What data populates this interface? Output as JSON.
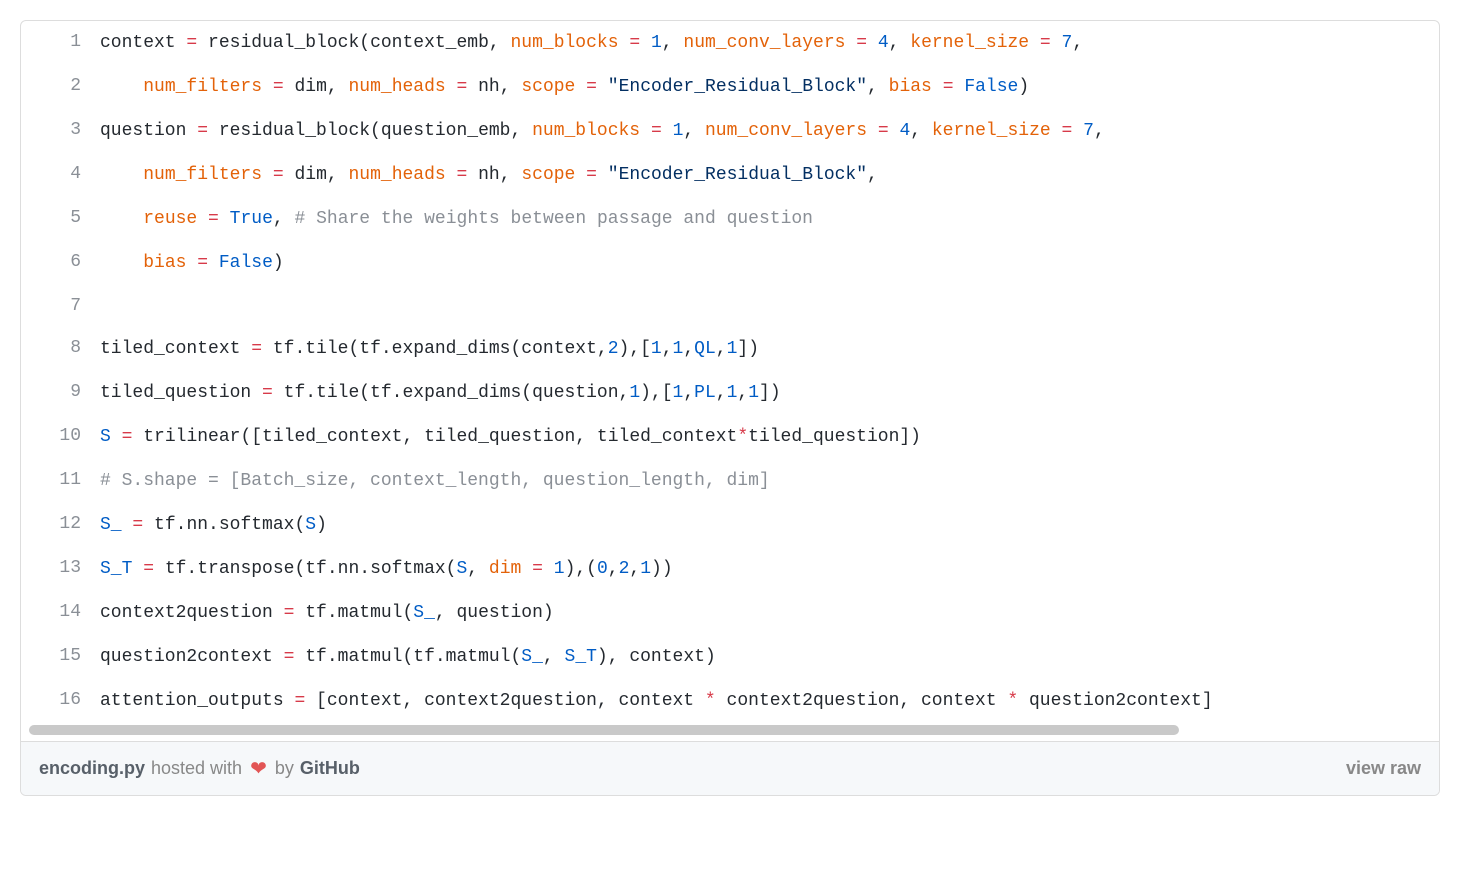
{
  "lines": [
    {
      "n": "1",
      "tokens": [
        {
          "t": "context ",
          "c": "tok-default"
        },
        {
          "t": "=",
          "c": "tok-op"
        },
        {
          "t": " residual_block(context_emb, ",
          "c": "tok-fn"
        },
        {
          "t": "num_blocks",
          "c": "tok-kw"
        },
        {
          "t": " ",
          "c": "tok-default"
        },
        {
          "t": "=",
          "c": "tok-op"
        },
        {
          "t": " ",
          "c": "tok-default"
        },
        {
          "t": "1",
          "c": "tok-num"
        },
        {
          "t": ", ",
          "c": "tok-default"
        },
        {
          "t": "num_conv_layers",
          "c": "tok-kw"
        },
        {
          "t": " ",
          "c": "tok-default"
        },
        {
          "t": "=",
          "c": "tok-op"
        },
        {
          "t": " ",
          "c": "tok-default"
        },
        {
          "t": "4",
          "c": "tok-num"
        },
        {
          "t": ", ",
          "c": "tok-default"
        },
        {
          "t": "kernel_size",
          "c": "tok-kw"
        },
        {
          "t": " ",
          "c": "tok-default"
        },
        {
          "t": "=",
          "c": "tok-op"
        },
        {
          "t": " ",
          "c": "tok-default"
        },
        {
          "t": "7",
          "c": "tok-num"
        },
        {
          "t": ",",
          "c": "tok-default"
        }
      ]
    },
    {
      "n": "2",
      "tokens": [
        {
          "t": "    ",
          "c": "tok-default"
        },
        {
          "t": "num_filters",
          "c": "tok-kw"
        },
        {
          "t": " ",
          "c": "tok-default"
        },
        {
          "t": "=",
          "c": "tok-op"
        },
        {
          "t": " dim, ",
          "c": "tok-default"
        },
        {
          "t": "num_heads",
          "c": "tok-kw"
        },
        {
          "t": " ",
          "c": "tok-default"
        },
        {
          "t": "=",
          "c": "tok-op"
        },
        {
          "t": " nh, ",
          "c": "tok-default"
        },
        {
          "t": "scope",
          "c": "tok-kw"
        },
        {
          "t": " ",
          "c": "tok-default"
        },
        {
          "t": "=",
          "c": "tok-op"
        },
        {
          "t": " ",
          "c": "tok-default"
        },
        {
          "t": "\"Encoder_Residual_Block\"",
          "c": "tok-str"
        },
        {
          "t": ", ",
          "c": "tok-default"
        },
        {
          "t": "bias",
          "c": "tok-kw"
        },
        {
          "t": " ",
          "c": "tok-default"
        },
        {
          "t": "=",
          "c": "tok-op"
        },
        {
          "t": " ",
          "c": "tok-default"
        },
        {
          "t": "False",
          "c": "tok-const"
        },
        {
          "t": ")",
          "c": "tok-default"
        }
      ]
    },
    {
      "n": "3",
      "tokens": [
        {
          "t": "question ",
          "c": "tok-default"
        },
        {
          "t": "=",
          "c": "tok-op"
        },
        {
          "t": " residual_block(question_emb, ",
          "c": "tok-fn"
        },
        {
          "t": "num_blocks",
          "c": "tok-kw"
        },
        {
          "t": " ",
          "c": "tok-default"
        },
        {
          "t": "=",
          "c": "tok-op"
        },
        {
          "t": " ",
          "c": "tok-default"
        },
        {
          "t": "1",
          "c": "tok-num"
        },
        {
          "t": ", ",
          "c": "tok-default"
        },
        {
          "t": "num_conv_layers",
          "c": "tok-kw"
        },
        {
          "t": " ",
          "c": "tok-default"
        },
        {
          "t": "=",
          "c": "tok-op"
        },
        {
          "t": " ",
          "c": "tok-default"
        },
        {
          "t": "4",
          "c": "tok-num"
        },
        {
          "t": ", ",
          "c": "tok-default"
        },
        {
          "t": "kernel_size",
          "c": "tok-kw"
        },
        {
          "t": " ",
          "c": "tok-default"
        },
        {
          "t": "=",
          "c": "tok-op"
        },
        {
          "t": " ",
          "c": "tok-default"
        },
        {
          "t": "7",
          "c": "tok-num"
        },
        {
          "t": ",",
          "c": "tok-default"
        }
      ]
    },
    {
      "n": "4",
      "tokens": [
        {
          "t": "    ",
          "c": "tok-default"
        },
        {
          "t": "num_filters",
          "c": "tok-kw"
        },
        {
          "t": " ",
          "c": "tok-default"
        },
        {
          "t": "=",
          "c": "tok-op"
        },
        {
          "t": " dim, ",
          "c": "tok-default"
        },
        {
          "t": "num_heads",
          "c": "tok-kw"
        },
        {
          "t": " ",
          "c": "tok-default"
        },
        {
          "t": "=",
          "c": "tok-op"
        },
        {
          "t": " nh, ",
          "c": "tok-default"
        },
        {
          "t": "scope",
          "c": "tok-kw"
        },
        {
          "t": " ",
          "c": "tok-default"
        },
        {
          "t": "=",
          "c": "tok-op"
        },
        {
          "t": " ",
          "c": "tok-default"
        },
        {
          "t": "\"Encoder_Residual_Block\"",
          "c": "tok-str"
        },
        {
          "t": ",",
          "c": "tok-default"
        }
      ]
    },
    {
      "n": "5",
      "tokens": [
        {
          "t": "    ",
          "c": "tok-default"
        },
        {
          "t": "reuse",
          "c": "tok-kw"
        },
        {
          "t": " ",
          "c": "tok-default"
        },
        {
          "t": "=",
          "c": "tok-op"
        },
        {
          "t": " ",
          "c": "tok-default"
        },
        {
          "t": "True",
          "c": "tok-const"
        },
        {
          "t": ", ",
          "c": "tok-default"
        },
        {
          "t": "# Share the weights between passage and question",
          "c": "tok-comment"
        }
      ]
    },
    {
      "n": "6",
      "tokens": [
        {
          "t": "    ",
          "c": "tok-default"
        },
        {
          "t": "bias",
          "c": "tok-kw"
        },
        {
          "t": " ",
          "c": "tok-default"
        },
        {
          "t": "=",
          "c": "tok-op"
        },
        {
          "t": " ",
          "c": "tok-default"
        },
        {
          "t": "False",
          "c": "tok-const"
        },
        {
          "t": ")",
          "c": "tok-default"
        }
      ]
    },
    {
      "n": "7",
      "tokens": [
        {
          "t": "",
          "c": "tok-default"
        }
      ]
    },
    {
      "n": "8",
      "tokens": [
        {
          "t": "tiled_context ",
          "c": "tok-default"
        },
        {
          "t": "=",
          "c": "tok-op"
        },
        {
          "t": " tf.tile(tf.expand_dims(context,",
          "c": "tok-default"
        },
        {
          "t": "2",
          "c": "tok-num"
        },
        {
          "t": "),[",
          "c": "tok-default"
        },
        {
          "t": "1",
          "c": "tok-num"
        },
        {
          "t": ",",
          "c": "tok-default"
        },
        {
          "t": "1",
          "c": "tok-num"
        },
        {
          "t": ",",
          "c": "tok-default"
        },
        {
          "t": "QL",
          "c": "tok-name"
        },
        {
          "t": ",",
          "c": "tok-default"
        },
        {
          "t": "1",
          "c": "tok-num"
        },
        {
          "t": "])",
          "c": "tok-default"
        }
      ]
    },
    {
      "n": "9",
      "tokens": [
        {
          "t": "tiled_question ",
          "c": "tok-default"
        },
        {
          "t": "=",
          "c": "tok-op"
        },
        {
          "t": " tf.tile(tf.expand_dims(question,",
          "c": "tok-default"
        },
        {
          "t": "1",
          "c": "tok-num"
        },
        {
          "t": "),[",
          "c": "tok-default"
        },
        {
          "t": "1",
          "c": "tok-num"
        },
        {
          "t": ",",
          "c": "tok-default"
        },
        {
          "t": "PL",
          "c": "tok-name"
        },
        {
          "t": ",",
          "c": "tok-default"
        },
        {
          "t": "1",
          "c": "tok-num"
        },
        {
          "t": ",",
          "c": "tok-default"
        },
        {
          "t": "1",
          "c": "tok-num"
        },
        {
          "t": "])",
          "c": "tok-default"
        }
      ]
    },
    {
      "n": "10",
      "tokens": [
        {
          "t": "S",
          "c": "tok-name"
        },
        {
          "t": " ",
          "c": "tok-default"
        },
        {
          "t": "=",
          "c": "tok-op"
        },
        {
          "t": " trilinear([tiled_context, tiled_question, tiled_context",
          "c": "tok-default"
        },
        {
          "t": "*",
          "c": "tok-op"
        },
        {
          "t": "tiled_question])",
          "c": "tok-default"
        }
      ]
    },
    {
      "n": "11",
      "tokens": [
        {
          "t": "# S.shape = [Batch_size, context_length, question_length, dim]",
          "c": "tok-comment"
        }
      ]
    },
    {
      "n": "12",
      "tokens": [
        {
          "t": "S_",
          "c": "tok-name"
        },
        {
          "t": " ",
          "c": "tok-default"
        },
        {
          "t": "=",
          "c": "tok-op"
        },
        {
          "t": " tf.nn.softmax(",
          "c": "tok-default"
        },
        {
          "t": "S",
          "c": "tok-name"
        },
        {
          "t": ")",
          "c": "tok-default"
        }
      ]
    },
    {
      "n": "13",
      "tokens": [
        {
          "t": "S_T",
          "c": "tok-name"
        },
        {
          "t": " ",
          "c": "tok-default"
        },
        {
          "t": "=",
          "c": "tok-op"
        },
        {
          "t": " tf.transpose(tf.nn.softmax(",
          "c": "tok-default"
        },
        {
          "t": "S",
          "c": "tok-name"
        },
        {
          "t": ", ",
          "c": "tok-default"
        },
        {
          "t": "dim",
          "c": "tok-kw"
        },
        {
          "t": " ",
          "c": "tok-default"
        },
        {
          "t": "=",
          "c": "tok-op"
        },
        {
          "t": " ",
          "c": "tok-default"
        },
        {
          "t": "1",
          "c": "tok-num"
        },
        {
          "t": "),(",
          "c": "tok-default"
        },
        {
          "t": "0",
          "c": "tok-num"
        },
        {
          "t": ",",
          "c": "tok-default"
        },
        {
          "t": "2",
          "c": "tok-num"
        },
        {
          "t": ",",
          "c": "tok-default"
        },
        {
          "t": "1",
          "c": "tok-num"
        },
        {
          "t": "))",
          "c": "tok-default"
        }
      ]
    },
    {
      "n": "14",
      "tokens": [
        {
          "t": "context2question ",
          "c": "tok-default"
        },
        {
          "t": "=",
          "c": "tok-op"
        },
        {
          "t": " tf.matmul(",
          "c": "tok-default"
        },
        {
          "t": "S_",
          "c": "tok-name"
        },
        {
          "t": ", question)",
          "c": "tok-default"
        }
      ]
    },
    {
      "n": "15",
      "tokens": [
        {
          "t": "question2context ",
          "c": "tok-default"
        },
        {
          "t": "=",
          "c": "tok-op"
        },
        {
          "t": " tf.matmul(tf.matmul(",
          "c": "tok-default"
        },
        {
          "t": "S_",
          "c": "tok-name"
        },
        {
          "t": ", ",
          "c": "tok-default"
        },
        {
          "t": "S_T",
          "c": "tok-name"
        },
        {
          "t": "), context)",
          "c": "tok-default"
        }
      ]
    },
    {
      "n": "16",
      "tokens": [
        {
          "t": "attention_outputs ",
          "c": "tok-default"
        },
        {
          "t": "=",
          "c": "tok-op"
        },
        {
          "t": " [context, context2question, context ",
          "c": "tok-default"
        },
        {
          "t": "*",
          "c": "tok-op"
        },
        {
          "t": " context2question, context ",
          "c": "tok-default"
        },
        {
          "t": "*",
          "c": "tok-op"
        },
        {
          "t": " question2context]",
          "c": "tok-default"
        }
      ]
    }
  ],
  "meta": {
    "filename": "encoding.py",
    "hosted_with": "hosted with",
    "by": "by",
    "github": "GitHub",
    "view_raw": "view raw"
  }
}
